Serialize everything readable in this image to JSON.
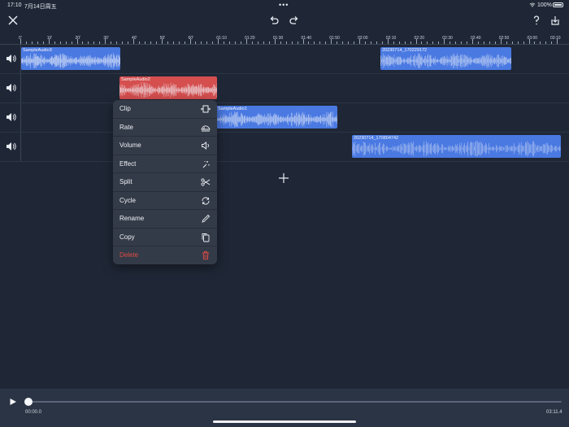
{
  "status_bar": {
    "time": "17:10",
    "date": "7月14日周五",
    "dots": "•••",
    "battery_pct": "100%"
  },
  "toolbar": {
    "close_icon": "close-icon",
    "undo_icon": "undo-icon",
    "redo_icon": "redo-icon",
    "help_icon": "help-icon",
    "export_icon": "export-icon"
  },
  "ruler": {
    "labels": [
      "0'",
      "10'",
      "20'",
      "30'",
      "40'",
      "50'",
      "60'",
      "01:10",
      "01:20",
      "01:30",
      "01:40",
      "01:50",
      "02:00",
      "02:10",
      "02:20",
      "02:30",
      "02:40",
      "02:50",
      "03:00",
      "03:10"
    ]
  },
  "tracks": [
    {
      "clips": [
        {
          "name": "SampleAudio3",
          "color": "blue"
        },
        {
          "name": "20230714_170229172",
          "color": "blue"
        }
      ]
    },
    {
      "clips": [
        {
          "name": "SampleAudio2",
          "color": "red"
        }
      ]
    },
    {
      "clips": [
        {
          "name": "SampleAudio1",
          "color": "blue"
        }
      ]
    },
    {
      "clips": [
        {
          "name": "20230714_170804742",
          "color": "blue"
        }
      ]
    }
  ],
  "menu": {
    "items": [
      {
        "label": "Clip",
        "icon": "clip-icon"
      },
      {
        "label": "Rate",
        "icon": "rate-icon"
      },
      {
        "label": "Volume",
        "icon": "volume-icon"
      },
      {
        "label": "Effect",
        "icon": "effect-icon"
      },
      {
        "label": "Split",
        "icon": "scissors-icon"
      },
      {
        "label": "Cycle",
        "icon": "cycle-icon"
      },
      {
        "label": "Rename",
        "icon": "pencil-icon"
      },
      {
        "label": "Copy",
        "icon": "copy-icon"
      },
      {
        "label": "Delete",
        "icon": "trash-icon"
      }
    ]
  },
  "player": {
    "current_time": "00:00.0",
    "total_time": "03:11.4",
    "progress": 0.0
  },
  "colors": {
    "background": "#1f2736",
    "clip_blue": "#4a79e2",
    "clip_red": "#d54f4f",
    "menu_bg": "#343b48",
    "danger": "#e04b44"
  }
}
